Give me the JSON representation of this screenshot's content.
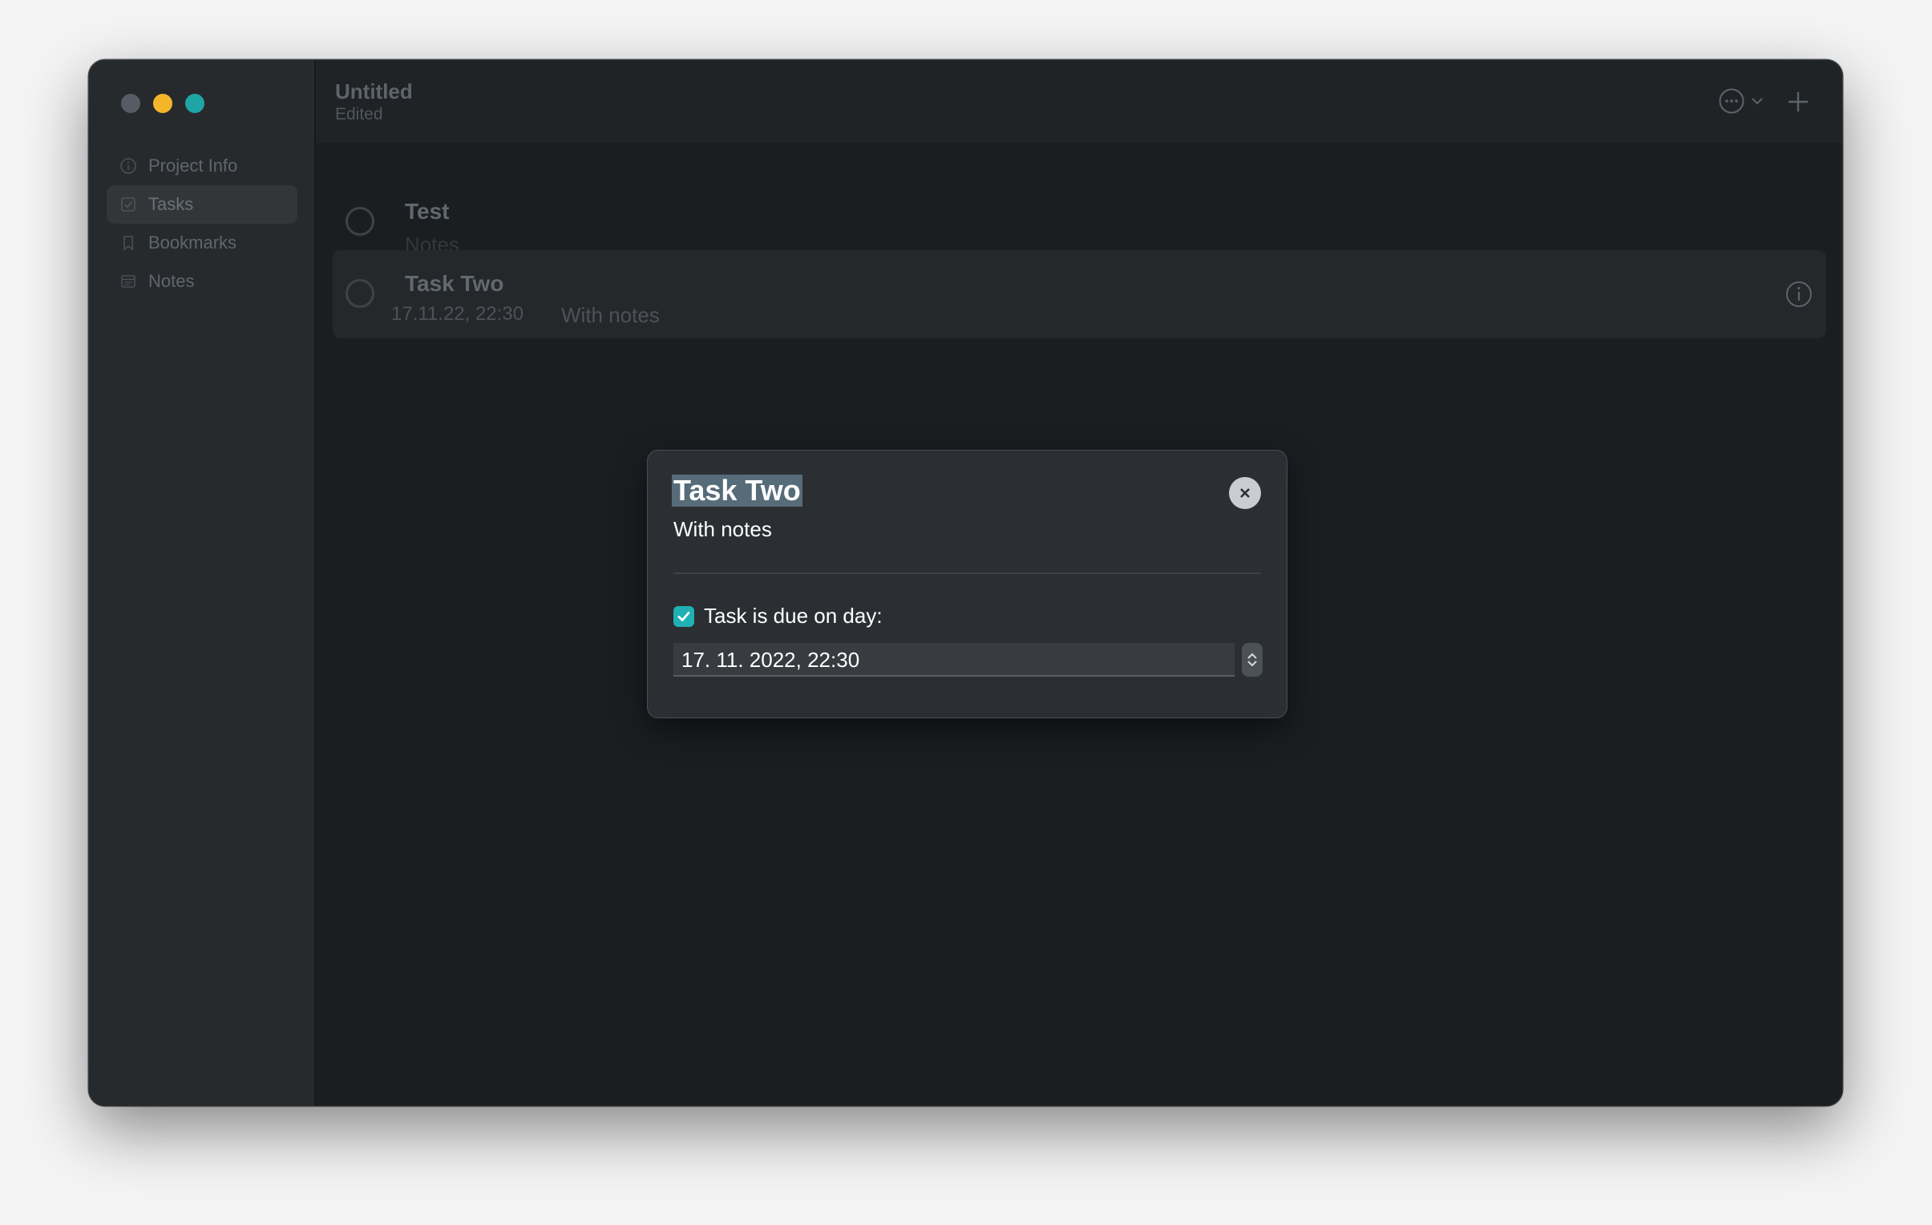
{
  "window": {
    "title": "Untitled",
    "subtitle": "Edited"
  },
  "sidebar": {
    "items": [
      {
        "label": "Project Info",
        "icon": "info-circle-icon",
        "active": false
      },
      {
        "label": "Tasks",
        "icon": "checkbox-icon",
        "active": true
      },
      {
        "label": "Bookmarks",
        "icon": "bookmark-icon",
        "active": false
      },
      {
        "label": "Notes",
        "icon": "note-icon",
        "active": false
      }
    ]
  },
  "toolbar": {
    "more_icon": "ellipsis-circle-icon",
    "chevron_icon": "chevron-down-icon",
    "add_icon": "plus-icon"
  },
  "tasks": [
    {
      "title": "Test",
      "notes_placeholder": "Notes"
    },
    {
      "title": "Task Two",
      "due": "17.11.22, 22:30",
      "notes": "With notes"
    }
  ],
  "popover": {
    "title": "Task Two",
    "notes": "With notes",
    "due_checkbox_label": "Task is due on day:",
    "due_checked": true,
    "due_value": "17. 11. 2022,  22:30"
  },
  "colors": {
    "accent": "#1fb1b3",
    "traffic_min": "#f5b52a",
    "traffic_max": "#20a5a6",
    "window_bg": "#1b1e21",
    "sidebar_bg": "#272a2d",
    "popover_bg": "#2b2f33"
  }
}
